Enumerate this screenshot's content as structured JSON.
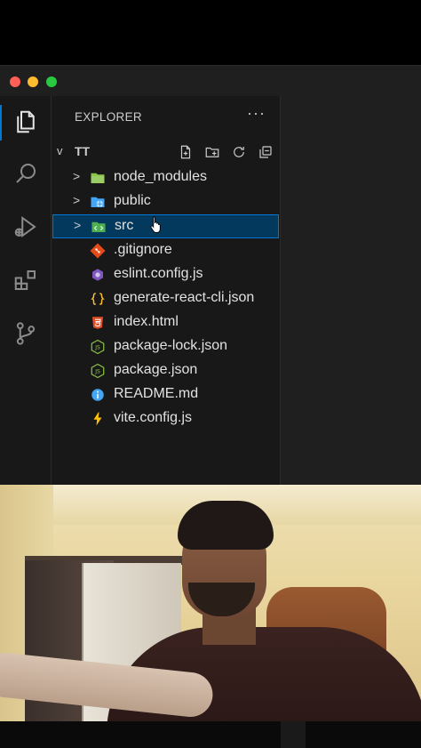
{
  "explorer": {
    "header": "EXPLORER",
    "more": "···",
    "folder": {
      "chevron": "v",
      "name": "TT"
    },
    "items": [
      {
        "type": "folder",
        "chevron": ">",
        "label": "node_modules",
        "icon": "folder-green-icon",
        "color": "#8bc34a"
      },
      {
        "type": "folder",
        "chevron": ">",
        "label": "public",
        "icon": "folder-globe-icon",
        "color": "#42a5f5"
      },
      {
        "type": "folder",
        "chevron": ">",
        "label": "src",
        "icon": "folder-src-icon",
        "color": "#4caf50",
        "selected": true
      },
      {
        "type": "file",
        "label": ".gitignore",
        "icon": "git-icon",
        "color": "#e64a19"
      },
      {
        "type": "file",
        "label": "eslint.config.js",
        "icon": "eslint-icon",
        "color": "#7e57c2"
      },
      {
        "type": "file",
        "label": "generate-react-cli.json",
        "icon": "json-braces-icon",
        "color": "#fbc02d"
      },
      {
        "type": "file",
        "label": "index.html",
        "icon": "html5-icon",
        "color": "#e44d26"
      },
      {
        "type": "file",
        "label": "package-lock.json",
        "icon": "nodejs-icon",
        "color": "#8bc34a"
      },
      {
        "type": "file",
        "label": "package.json",
        "icon": "nodejs-icon",
        "color": "#8bc34a"
      },
      {
        "type": "file",
        "label": "README.md",
        "icon": "info-icon",
        "color": "#42a5f5"
      },
      {
        "type": "file",
        "label": "vite.config.js",
        "icon": "vite-bolt-icon",
        "color": "#ffc107"
      }
    ]
  },
  "colors": {
    "selection_bg": "#04395e",
    "selection_border": "#0078d4",
    "sidebar_bg": "#181818"
  }
}
